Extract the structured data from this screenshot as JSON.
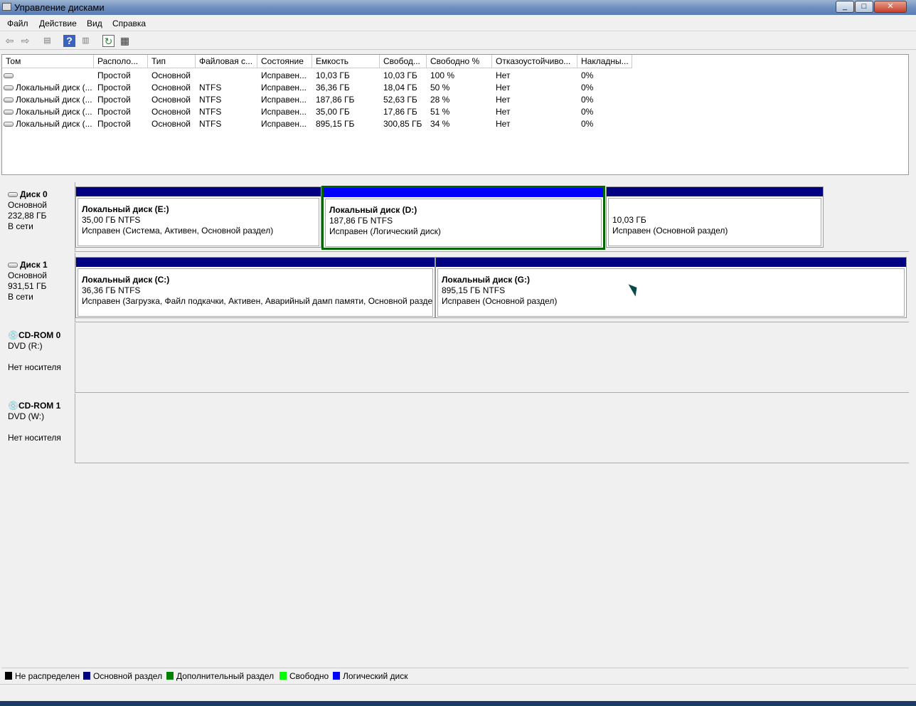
{
  "window": {
    "title": "Управление дисками",
    "minimize": "_",
    "maximize": "□",
    "close": "✕"
  },
  "menu": [
    "Файл",
    "Действие",
    "Вид",
    "Справка"
  ],
  "toolbar": [
    "back-icon",
    "forward-icon",
    "console-tree-icon",
    "help-icon",
    "action-pane-icon",
    "refresh-icon",
    "properties-icon"
  ],
  "volumes": {
    "columns": [
      "Том",
      "Располо...",
      "Тип",
      "Файловая с...",
      "Состояние",
      "Емкость",
      "Свобод...",
      "Свободно %",
      "Отказоустойчиво...",
      "Накладны..."
    ],
    "rows": [
      [
        "",
        "Простой",
        "Основной",
        "",
        "Исправен...",
        "10,03 ГБ",
        "10,03 ГБ",
        "100 %",
        "Нет",
        "0%"
      ],
      [
        "Локальный диск (...",
        "Простой",
        "Основной",
        "NTFS",
        "Исправен...",
        "36,36 ГБ",
        "18,04 ГБ",
        "50 %",
        "Нет",
        "0%"
      ],
      [
        "Локальный диск (...",
        "Простой",
        "Основной",
        "NTFS",
        "Исправен...",
        "187,86 ГБ",
        "52,63 ГБ",
        "28 %",
        "Нет",
        "0%"
      ],
      [
        "Локальный диск (...",
        "Простой",
        "Основной",
        "NTFS",
        "Исправен...",
        "35,00 ГБ",
        "17,86 ГБ",
        "51 %",
        "Нет",
        "0%"
      ],
      [
        "Локальный диск (...",
        "Простой",
        "Основной",
        "NTFS",
        "Исправен...",
        "895,15 ГБ",
        "300,85 ГБ",
        "34 %",
        "Нет",
        "0%"
      ]
    ]
  },
  "disks": [
    {
      "name": "Диск 0",
      "type": "Основной",
      "size": "232,88 ГБ",
      "status": "В сети",
      "partitions": [
        {
          "name": "Локальный диск  (E:)",
          "size": "35,00 ГБ NTFS",
          "status": "Исправен (Система, Активен, Основной раздел)",
          "kind": "primary"
        },
        {
          "name": "Локальный диск  (D:)",
          "size": "187,86 ГБ NTFS",
          "status": "Исправен (Логический диск)",
          "kind": "logical"
        },
        {
          "name": "",
          "size": "10,03 ГБ",
          "status": "Исправен (Основной раздел)",
          "kind": "primary"
        }
      ]
    },
    {
      "name": "Диск 1",
      "type": "Основной",
      "size": "931,51 ГБ",
      "status": "В сети",
      "partitions": [
        {
          "name": "Локальный диск  (C:)",
          "size": "36,36 ГБ NTFS",
          "status": "Исправен (Загрузка, Файл подкачки, Активен, Аварийный дамп памяти, Основной разде.",
          "kind": "primary"
        },
        {
          "name": "Локальный диск  (G:)",
          "size": "895,15 ГБ NTFS",
          "status": "Исправен (Основной раздел)",
          "kind": "primary"
        }
      ]
    },
    {
      "name": "CD-ROM 0",
      "type": "DVD (R:)",
      "status": "Нет носителя"
    },
    {
      "name": "CD-ROM 1",
      "type": "DVD (W:)",
      "status": "Нет носителя"
    }
  ],
  "legend": [
    {
      "label": "Не распределен",
      "color": "#000000"
    },
    {
      "label": "Основной раздел",
      "color": "#000080"
    },
    {
      "label": "Дополнительный раздел",
      "color": "#008000"
    },
    {
      "label": "Свободно",
      "color": "#00ff00"
    },
    {
      "label": "Логический диск",
      "color": "#0000ff"
    }
  ]
}
